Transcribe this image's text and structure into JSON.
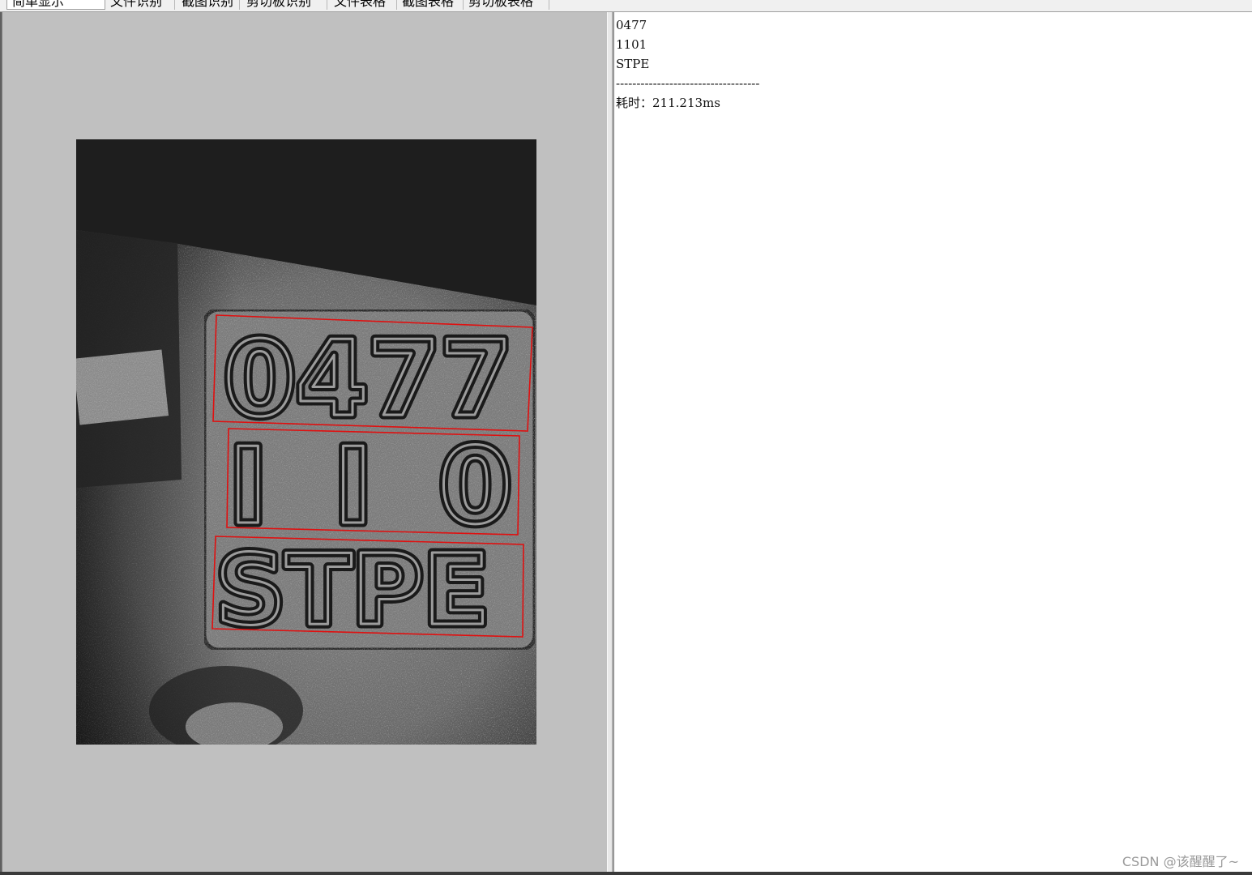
{
  "toolbar": {
    "buttons": [
      {
        "label": "简单显示",
        "active": true
      },
      {
        "label": "文件识别",
        "active": false
      },
      {
        "label": "截图识别",
        "active": false
      },
      {
        "label": "剪切板识别",
        "active": false
      },
      {
        "label": "文件表格",
        "active": false
      },
      {
        "label": "截图表格",
        "active": false
      },
      {
        "label": "剪切板表格",
        "active": false
      }
    ]
  },
  "image": {
    "detections": [
      {
        "text": "0477",
        "color": "#e01010"
      },
      {
        "text": "1101",
        "color": "#e01010"
      },
      {
        "text": "STPE",
        "color": "#e01010"
      }
    ]
  },
  "result": {
    "lines": [
      "0477",
      "1101",
      "STPE",
      "-----------------------------------",
      "耗时：211.213ms"
    ]
  },
  "watermark": "CSDN @该醒醒了~"
}
